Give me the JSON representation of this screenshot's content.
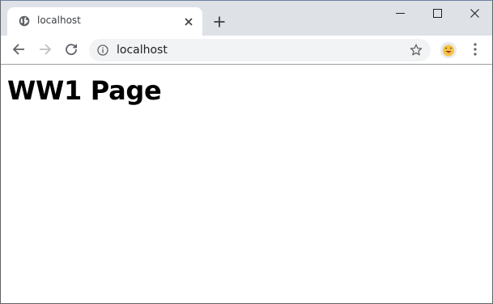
{
  "browser": {
    "tab": {
      "title": "localhost",
      "favicon_icon": "globe-icon",
      "close_icon": "close-icon"
    },
    "new_tab_icon": "plus-icon",
    "window_controls": {
      "minimize_icon": "minimize-icon",
      "maximize_icon": "maximize-icon",
      "close_icon": "close-icon"
    },
    "toolbar": {
      "back_icon": "arrow-left-icon",
      "forward_icon": "arrow-right-icon",
      "reload_icon": "reload-icon",
      "address": "localhost",
      "site_info_icon": "info-icon",
      "bookmark_icon": "star-icon",
      "profile_icon": "emoji-avatar-icon",
      "menu_icon": "kebab-menu-icon"
    },
    "colors": {
      "tabstrip_bg": "#dee1e6",
      "omnibox_bg": "#f1f3f4",
      "icon_gray": "#5f6368",
      "icon_disabled": "#bdc1c6"
    }
  },
  "page": {
    "heading": "WW1 Page"
  }
}
